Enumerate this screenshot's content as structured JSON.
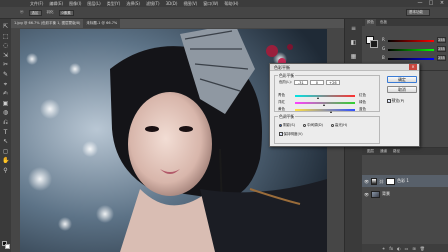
{
  "menubar": {
    "items": [
      "文件(F)",
      "编辑(E)",
      "图像(I)",
      "图层(L)",
      "类型(Y)",
      "选择(S)",
      "滤镜(T)",
      "3D(D)",
      "视图(V)",
      "窗口(W)",
      "帮助(H)"
    ],
    "controls": [
      "—",
      "□",
      "×"
    ]
  },
  "options_bar": {
    "tool_preset": "ⓜ",
    "fields": [
      "选区",
      "羽化",
      "0像素"
    ],
    "workspace": "基本功能"
  },
  "document_tabs": [
    "1.jpg @ 66.7% (色彩平衡 1, 图层蒙版/8)",
    "未标题-1 @ 66.7%"
  ],
  "tools": [
    "⇱",
    "⬚",
    "◌",
    "⇲",
    "✂",
    "✎",
    "⌖",
    "✍",
    "▣",
    "◍",
    "⎌",
    "T",
    "↖",
    "◻",
    "✋",
    "⚲"
  ],
  "dock_icons": [
    "≡",
    "◧",
    "▦",
    "⚙"
  ],
  "color_panel": {
    "tabs": [
      "颜色",
      "色板"
    ],
    "sliders": [
      {
        "label": "R",
        "value": "255"
      },
      {
        "label": "G",
        "value": "255"
      },
      {
        "label": "B",
        "value": "255"
      }
    ]
  },
  "layers_panel": {
    "tabs": [
      "图层",
      "通道",
      "路径"
    ],
    "layers": [
      {
        "name": "色彩 1",
        "selected": true
      },
      {
        "name": "背景",
        "selected": false
      }
    ],
    "footer_icons": [
      "⚭",
      "fx",
      "◐",
      "▭",
      "⊞",
      "🗑"
    ]
  },
  "dialog": {
    "title": "色彩平衡",
    "close": "×",
    "balance_group": {
      "title": "色彩平衡",
      "level_label": "色阶(L):",
      "levels": [
        "-31",
        "0",
        "+26"
      ],
      "sliders": [
        {
          "left": "青色",
          "right": "红色",
          "position": 0.38
        },
        {
          "left": "洋红",
          "right": "绿色",
          "position": 0.5
        },
        {
          "left": "黄色",
          "right": "蓝色",
          "position": 0.62
        }
      ]
    },
    "tone_group": {
      "title": "色调平衡",
      "options": [
        "阴影(S)",
        "中间调(D)",
        "高光(H)"
      ],
      "selected": 0,
      "preserve_luminosity": "保持明度(V)"
    },
    "buttons": {
      "ok": "确定",
      "cancel": "取消"
    },
    "preview": "预览(P)"
  }
}
